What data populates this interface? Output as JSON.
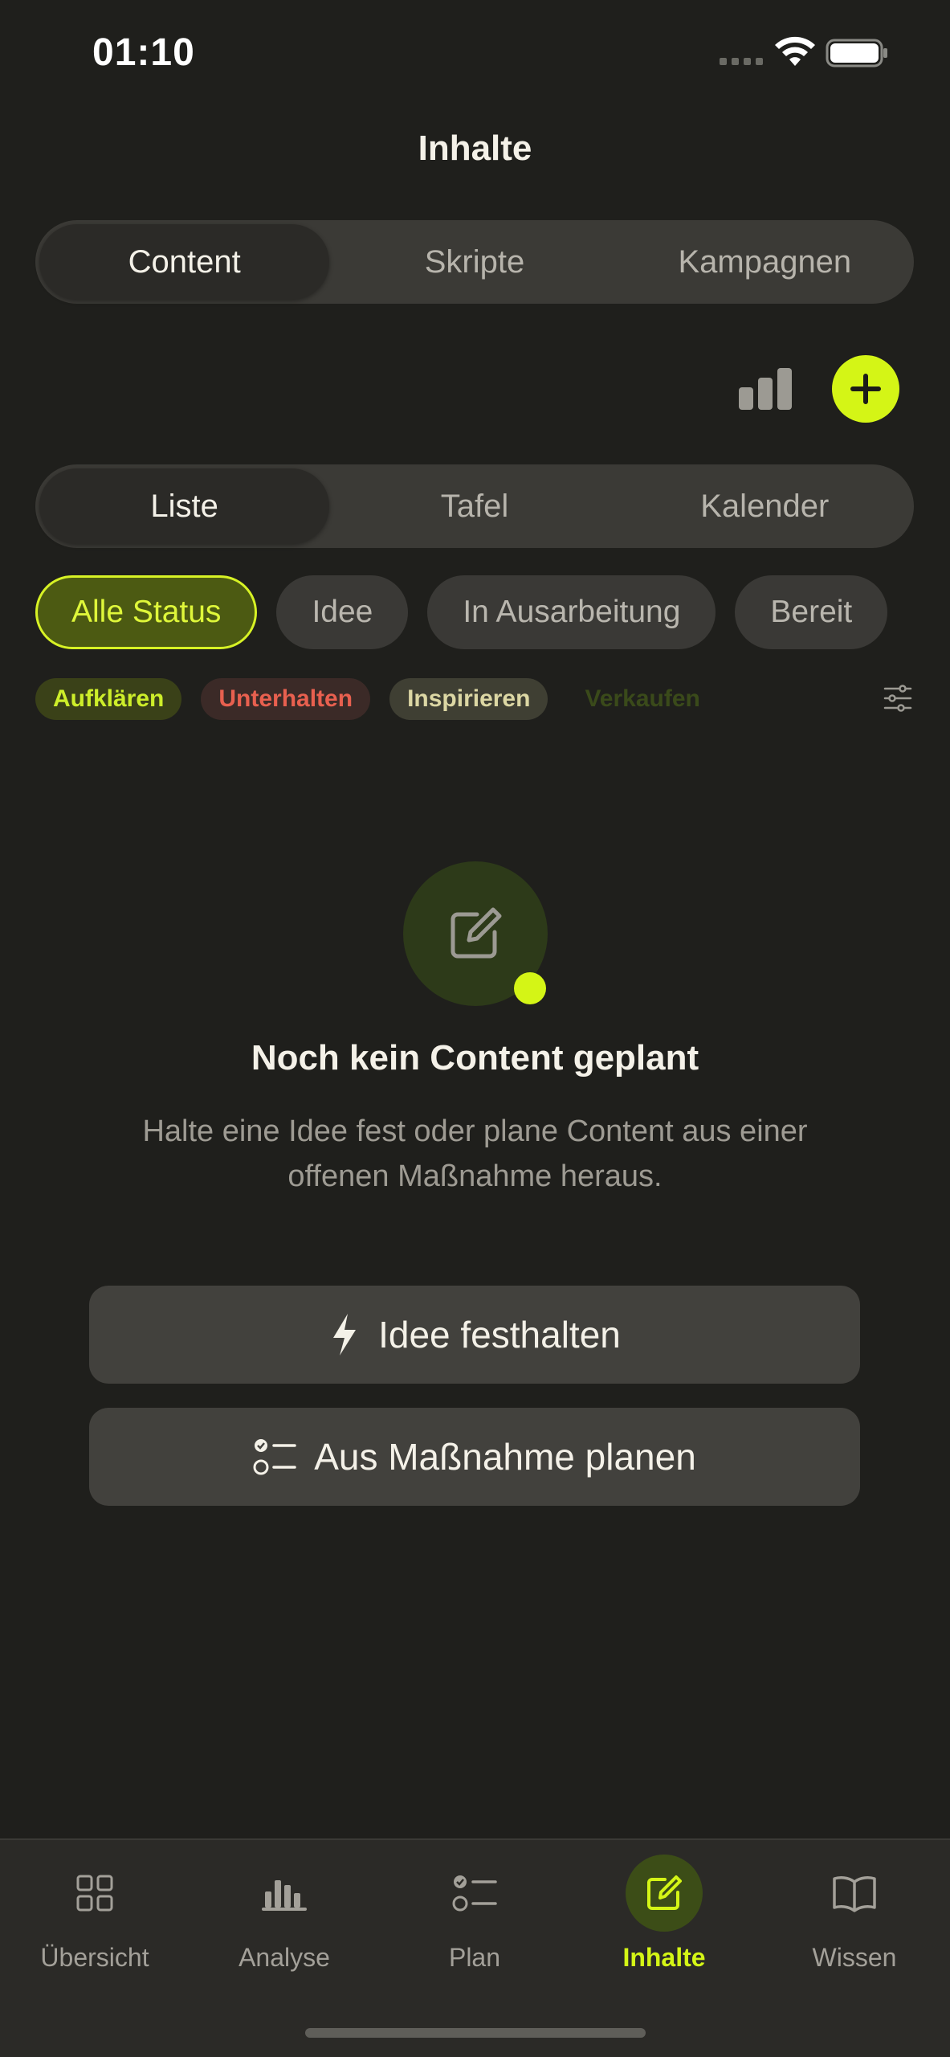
{
  "status_bar": {
    "time": "01:10"
  },
  "header": {
    "title": "Inhalte"
  },
  "top_tabs": [
    {
      "label": "Content",
      "active": true
    },
    {
      "label": "Skripte",
      "active": false
    },
    {
      "label": "Kampagnen",
      "active": false
    }
  ],
  "toolbar": {
    "stats_icon": "bar-chart-icon",
    "add_icon": "plus-icon"
  },
  "view_tabs": [
    {
      "label": "Liste",
      "active": true
    },
    {
      "label": "Tafel",
      "active": false
    },
    {
      "label": "Kalender",
      "active": false
    }
  ],
  "status_filters": [
    {
      "label": "Alle Status",
      "active": true
    },
    {
      "label": "Idee",
      "active": false
    },
    {
      "label": "In Ausarbeitung",
      "active": false
    },
    {
      "label": "Bereit",
      "active": false
    }
  ],
  "category_tags": [
    {
      "label": "Aufklären"
    },
    {
      "label": "Unterhalten"
    },
    {
      "label": "Inspirieren"
    },
    {
      "label": "Verkaufen"
    }
  ],
  "empty_state": {
    "title": "Noch kein Content geplant",
    "text": "Halte eine Idee fest oder plane Content aus einer offenen Maßnahme heraus.",
    "primary_button": "Idee festhalten",
    "secondary_button": "Aus Maßnahme planen"
  },
  "tab_bar": [
    {
      "label": "Übersicht",
      "icon": "grid-icon",
      "active": false
    },
    {
      "label": "Analyse",
      "icon": "analytics-icon",
      "active": false
    },
    {
      "label": "Plan",
      "icon": "checklist-icon",
      "active": false
    },
    {
      "label": "Inhalte",
      "icon": "edit-icon",
      "active": true
    },
    {
      "label": "Wissen",
      "icon": "book-icon",
      "active": false
    }
  ],
  "colors": {
    "background": "#1f1f1c",
    "accent": "#d4f516",
    "surface": "#3b3a36",
    "tag_red": "#e8604f"
  }
}
